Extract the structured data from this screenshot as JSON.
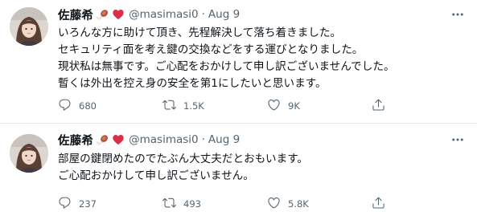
{
  "colors": {
    "text_primary": "#0f1419",
    "text_secondary": "#536471",
    "divider": "#e1e8ed",
    "heart": "#e0245e"
  },
  "tweets": [
    {
      "author": {
        "name": "佐藤希",
        "emojis": [
          "meat-on-bone-emoji",
          "red-heart-emoji"
        ],
        "handle": "@masimasi0",
        "dot": "·",
        "date": "Aug 9"
      },
      "lines": [
        "いろんな方に助けて頂き、先程解決して落ち着きました。",
        "セキュリティ面を考え鍵の交換などをする運びとなりました。",
        "現状私は無事です。ご心配をおかけして申し訳ございませんでした。",
        "暫くは外出を控え身の安全を第1にしたいと思います。"
      ],
      "stats": {
        "replies": "680",
        "retweets": "1.5K",
        "likes": "9K"
      }
    },
    {
      "author": {
        "name": "佐藤希",
        "emojis": [
          "meat-on-bone-emoji",
          "red-heart-emoji"
        ],
        "handle": "@masimasi0",
        "dot": "·",
        "date": "Aug 9"
      },
      "lines": [
        "部屋の鍵閉めたのでたぶん大丈夫だとおもいます。",
        "ご心配おかけして申し訳ございません。"
      ],
      "stats": {
        "replies": "237",
        "retweets": "493",
        "likes": "5.8K"
      }
    }
  ],
  "icons": {
    "more": "more-horizontal-icon",
    "reply": "reply-icon",
    "retweet": "retweet-icon",
    "like": "like-icon",
    "share": "share-icon"
  }
}
